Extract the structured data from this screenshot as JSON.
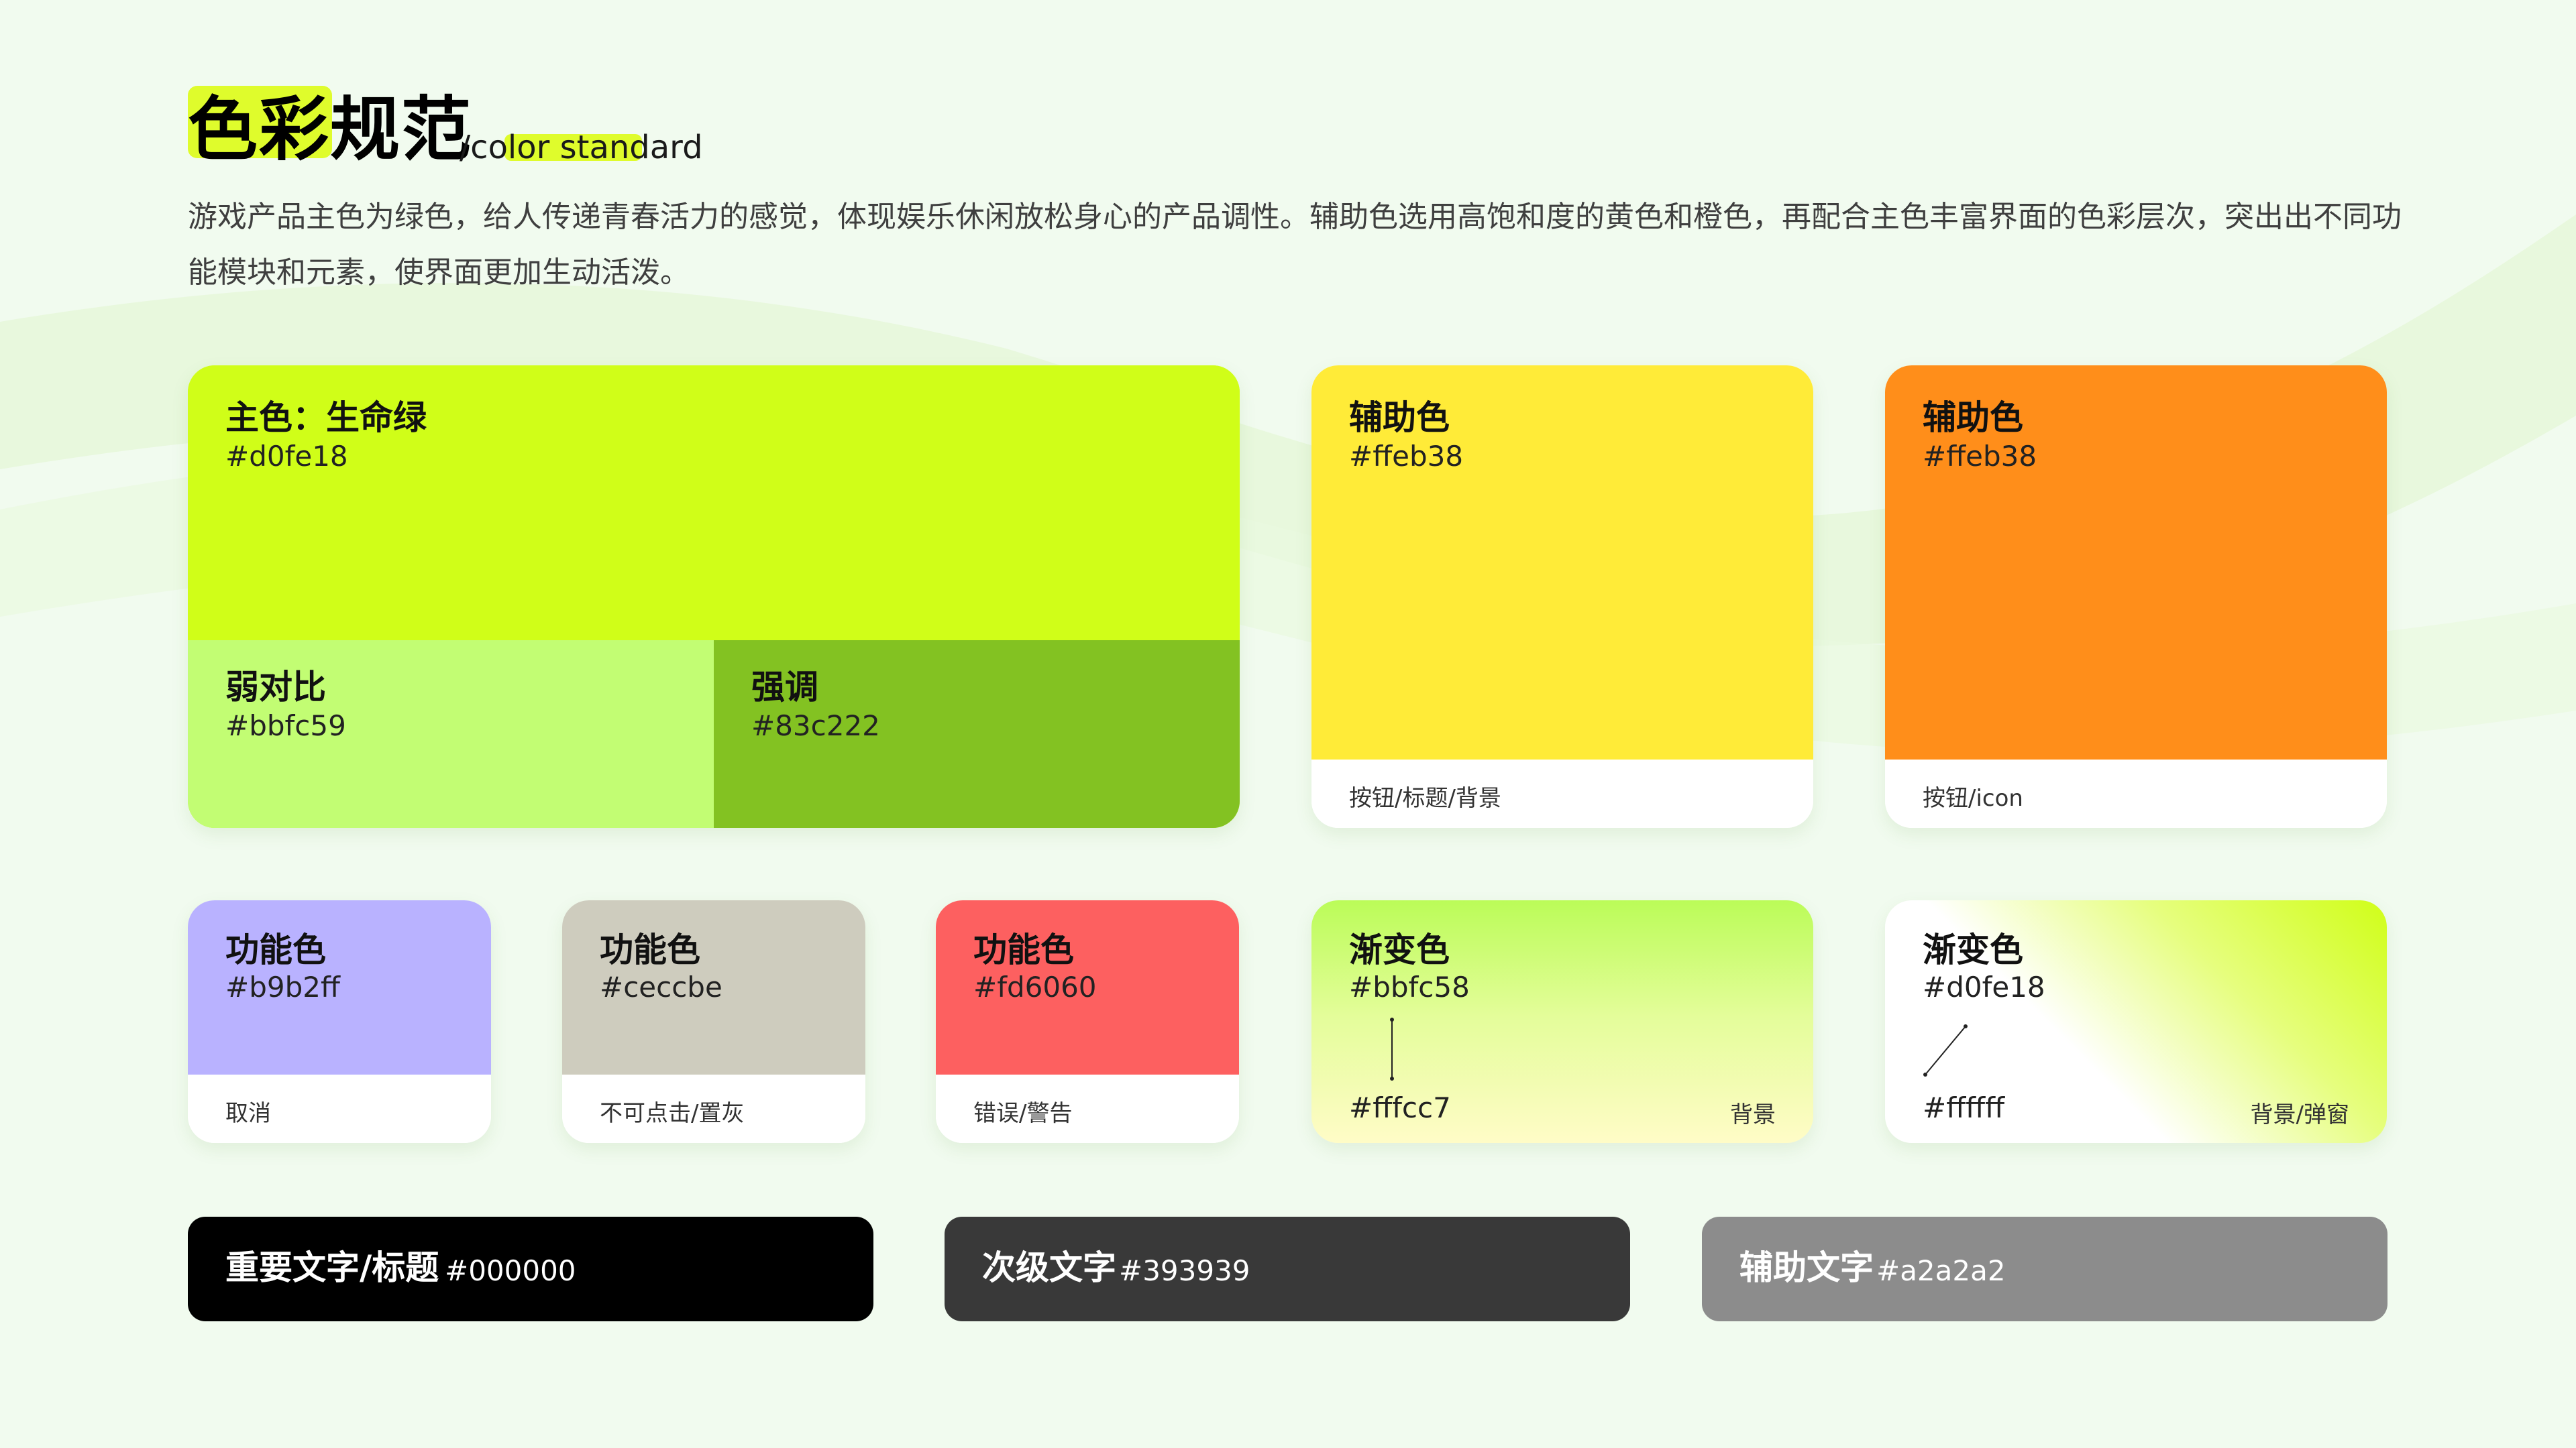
{
  "colors": {
    "background": "#f1fbef",
    "title_highlight": "#dffc2c"
  },
  "header": {
    "title": "色彩规范",
    "subtitle": "/color standard",
    "description": "游戏产品主色为绿色，给人传递青春活力的感觉，体现娱乐休闲放松身心的产品调性。辅助色选用高饱和度的黄色和橙色，再配合主色丰富界面的色彩层次，突出出不同功能模块和元素，使界面更加生动活泼。"
  },
  "primary": {
    "main": {
      "name": "主色：生命绿",
      "hex": "#d0fe18",
      "color": "#d0fe18"
    },
    "weak": {
      "name": "弱对比",
      "hex": "#bbfc59",
      "color": "#c2fd73"
    },
    "emphasis": {
      "name": "强调",
      "hex": "#83c222",
      "color": "#83c222"
    }
  },
  "auxiliary": [
    {
      "name": "辅助色",
      "hex": "#ffeb38",
      "usage": "按钮/标题/背景",
      "color": "#ffeb38"
    },
    {
      "name": "辅助色",
      "hex": "#ffeb38",
      "usage": "按钮/icon",
      "color": "#ff8e1a"
    }
  ],
  "functional": [
    {
      "name": "功能色",
      "hex": "#b9b2ff",
      "usage": "取消",
      "color": "#b9b2ff"
    },
    {
      "name": "功能色",
      "hex": "#ceccbe",
      "usage": "不可点击/置灰",
      "color": "#ceccbe"
    },
    {
      "name": "功能色",
      "hex": "#fd6060",
      "usage": "错误/警告",
      "color": "#fd6060"
    }
  ],
  "gradients": [
    {
      "name": "渐变色",
      "hex_start": "#bbfc58",
      "hex_end": "#fffcc7",
      "usage": "背景"
    },
    {
      "name": "渐变色",
      "hex_start": "#d0fe18",
      "hex_end": "#ffffff",
      "usage": "背景/弹窗"
    }
  ],
  "text_colors": [
    {
      "name": "重要文字/标题",
      "hex": "#000000",
      "color": "#000000"
    },
    {
      "name": "次级文字",
      "hex": "#393939",
      "color": "#393939"
    },
    {
      "name": "辅助文字",
      "hex": "#a2a2a2",
      "color": "#8c8c8c"
    }
  ]
}
